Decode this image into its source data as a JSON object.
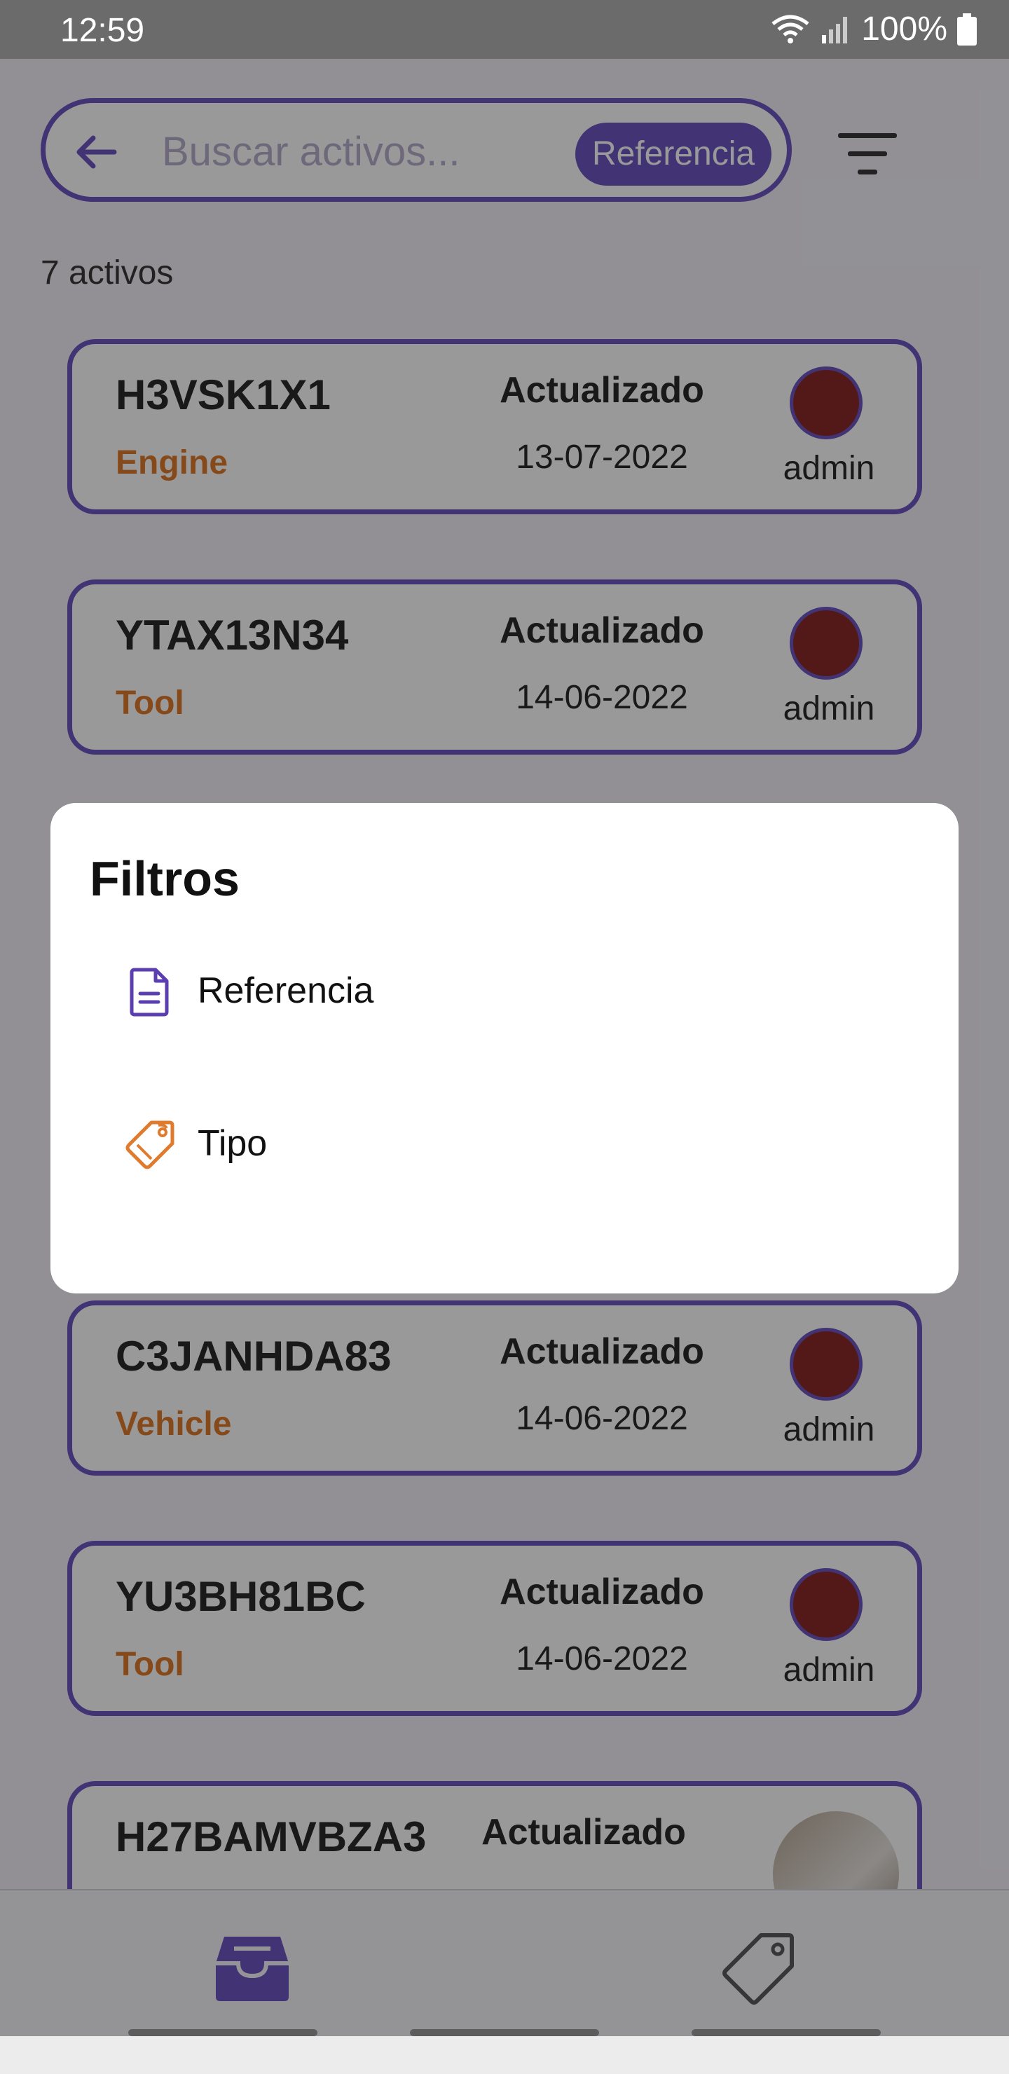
{
  "status_bar": {
    "time": "12:59",
    "battery": "100%"
  },
  "search": {
    "placeholder": "Buscar activos...",
    "chip": "Referencia"
  },
  "list": {
    "count": "7 activos",
    "cards": [
      {
        "ref": "H3VSK1X1",
        "type": "Engine",
        "status": "Actualizado",
        "date": "13-07-2022",
        "user": "admin"
      },
      {
        "ref": "YTAX13N34",
        "type": "Tool",
        "status": "Actualizado",
        "date": "14-06-2022",
        "user": "admin"
      },
      {
        "ref": "C3JANHDA83",
        "type": "Vehicle",
        "status": "Actualizado",
        "date": "14-06-2022",
        "user": "admin"
      },
      {
        "ref": "YU3BH81BC",
        "type": "Tool",
        "status": "Actualizado",
        "date": "14-06-2022",
        "user": "admin"
      },
      {
        "ref": "H27BAMVBZA3",
        "status": "Actualizado"
      }
    ]
  },
  "dialog": {
    "title": "Filtros",
    "options": [
      {
        "label": "Referencia",
        "icon": "document-icon",
        "color": "#5b3fb0"
      },
      {
        "label": "Tipo",
        "icon": "tag-icon",
        "color": "#e07a2c"
      }
    ]
  },
  "colors": {
    "accent": "#6f55c4",
    "type_label": "#e07a2c"
  },
  "bottom_nav": {
    "items": [
      "inbox-icon",
      "tag-icon"
    ]
  }
}
